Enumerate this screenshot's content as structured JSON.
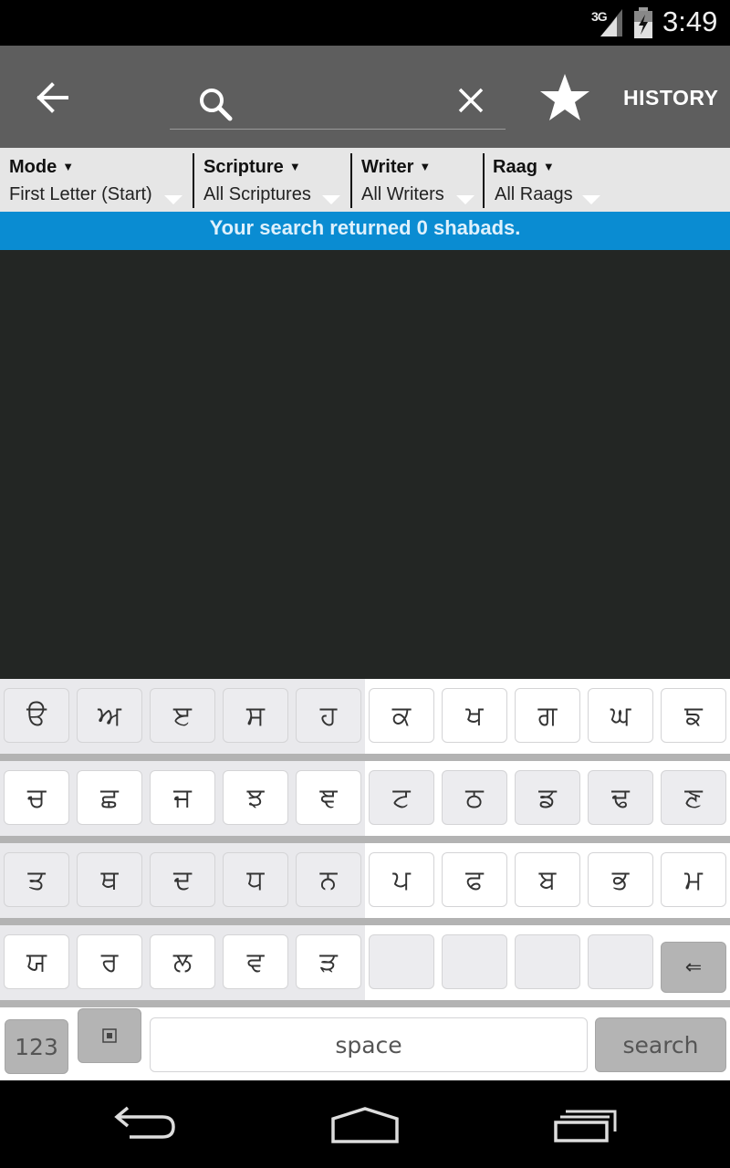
{
  "status_bar": {
    "network": "3G",
    "clock": "3:49"
  },
  "action_bar": {
    "search_placeholder": "",
    "search_value": "",
    "history_label": "HISTORY"
  },
  "filters": [
    {
      "title": "Mode",
      "value": "First Letter (Start)"
    },
    {
      "title": "Scripture",
      "value": "All Scriptures"
    },
    {
      "title": "Writer",
      "value": "All Writers"
    },
    {
      "title": "Raag",
      "value": "All Raags"
    }
  ],
  "filter_caret": "▼",
  "results_message": "Your search returned 0 shabads.",
  "keyboard": {
    "rows": [
      [
        "ੳ",
        "ਅ",
        "ੲ",
        "ਸ",
        "ਹ",
        "ਕ",
        "ਖ",
        "ਗ",
        "ਘ",
        "ਙ"
      ],
      [
        "ਚ",
        "ਛ",
        "ਜ",
        "ਝ",
        "ਞ",
        "ਟ",
        "ਠ",
        "ਡ",
        "ਢ",
        "ਣ"
      ],
      [
        "ਤ",
        "ਥ",
        "ਦ",
        "ਧ",
        "ਨ",
        "ਪ",
        "ਫ",
        "ਬ",
        "ਭ",
        "ਮ"
      ],
      [
        "ਯ",
        "ਰ",
        "ਲ",
        "ਵ",
        "ੜ",
        "",
        "",
        "",
        "",
        ""
      ]
    ],
    "backspace_glyph": "⇐",
    "numbers_label": "123",
    "space_label": "space",
    "search_label": "search"
  },
  "colors": {
    "action_bar": "#5e5e5e",
    "banner": "#0a8cd2",
    "content": "#232624"
  },
  "icons": [
    "back-arrow-icon",
    "search-icon",
    "close-icon",
    "star-icon",
    "backspace-icon",
    "keyboard-settings-icon",
    "nav-back-icon",
    "nav-home-icon",
    "nav-recents-icon"
  ]
}
